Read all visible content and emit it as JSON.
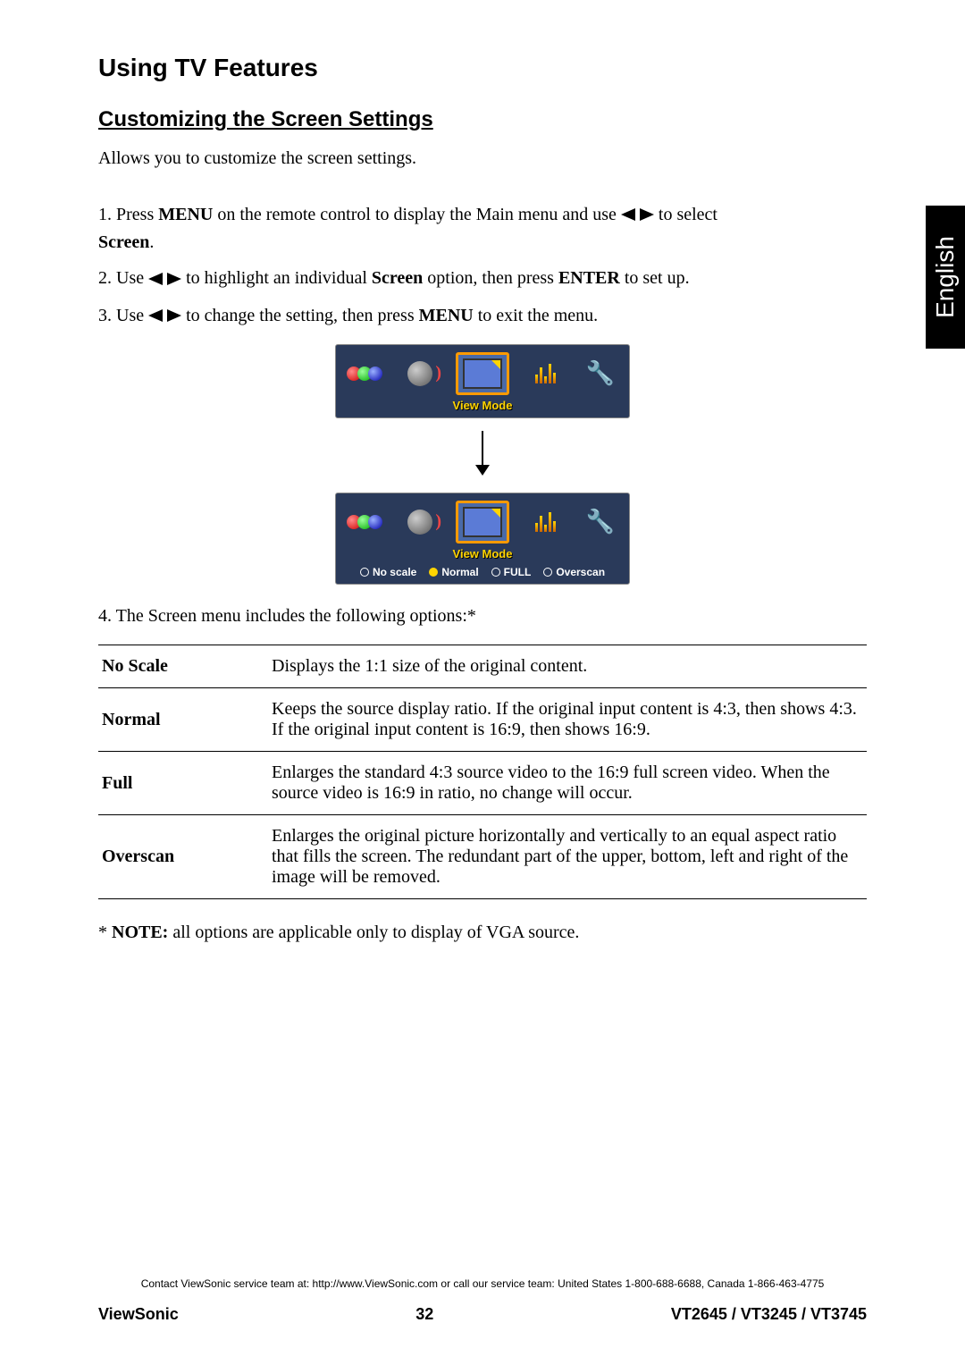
{
  "language_tab": "English",
  "section_title": "Using TV Features",
  "subsection_title": "Customizing the Screen Settings",
  "intro": "Allows you to customize the screen settings.",
  "steps": {
    "s1_a": "1. Press ",
    "s1_menu": "MENU",
    "s1_b": " on the remote control to display the Main menu and use ",
    "s1_c": " to select ",
    "s1_screen": "Screen",
    "s1_d": ".",
    "s2_a": "2. Use ",
    "s2_b": " to highlight an individual ",
    "s2_screen": "Screen",
    "s2_c": " option, then press ",
    "s2_enter": "ENTER",
    "s2_d": " to set up.",
    "s3_a": "3. Use ",
    "s3_b": " to change the setting, then press ",
    "s3_menu": "MENU",
    "s3_c": " to exit the menu."
  },
  "menu_label": "View Mode",
  "view_options": {
    "o1": "No scale",
    "o2": "Normal",
    "o3": "FULL",
    "o4": "Overscan"
  },
  "step4": "4. The Screen menu includes the following options:*",
  "table": [
    {
      "name": "No Scale",
      "desc": "Displays the 1:1 size of the original content."
    },
    {
      "name": "Normal",
      "desc": "Keeps the source display ratio. If the original input content is 4:3, then shows 4:3. If the original input content is 16:9, then shows 16:9."
    },
    {
      "name": "Full",
      "desc": "Enlarges the standard 4:3 source video to the 16:9 full screen video. When the source video is 16:9 in ratio, no change will occur."
    },
    {
      "name": "Overscan",
      "desc": "Enlarges the original picture horizontally and vertically to an equal aspect ratio that fills the screen. The redundant part of the upper, bottom, left and right of the image will be removed."
    }
  ],
  "note_prefix": "* ",
  "note_bold": "NOTE:",
  "note_text": " all options are applicable only to display of VGA source.",
  "footer_contact": "Contact ViewSonic service team at: http://www.ViewSonic.com or call our service team: United States 1-800-688-6688, Canada 1-866-463-4775",
  "footer": {
    "brand": "ViewSonic",
    "page": "32",
    "models": "VT2645 / VT3245 / VT3745"
  }
}
